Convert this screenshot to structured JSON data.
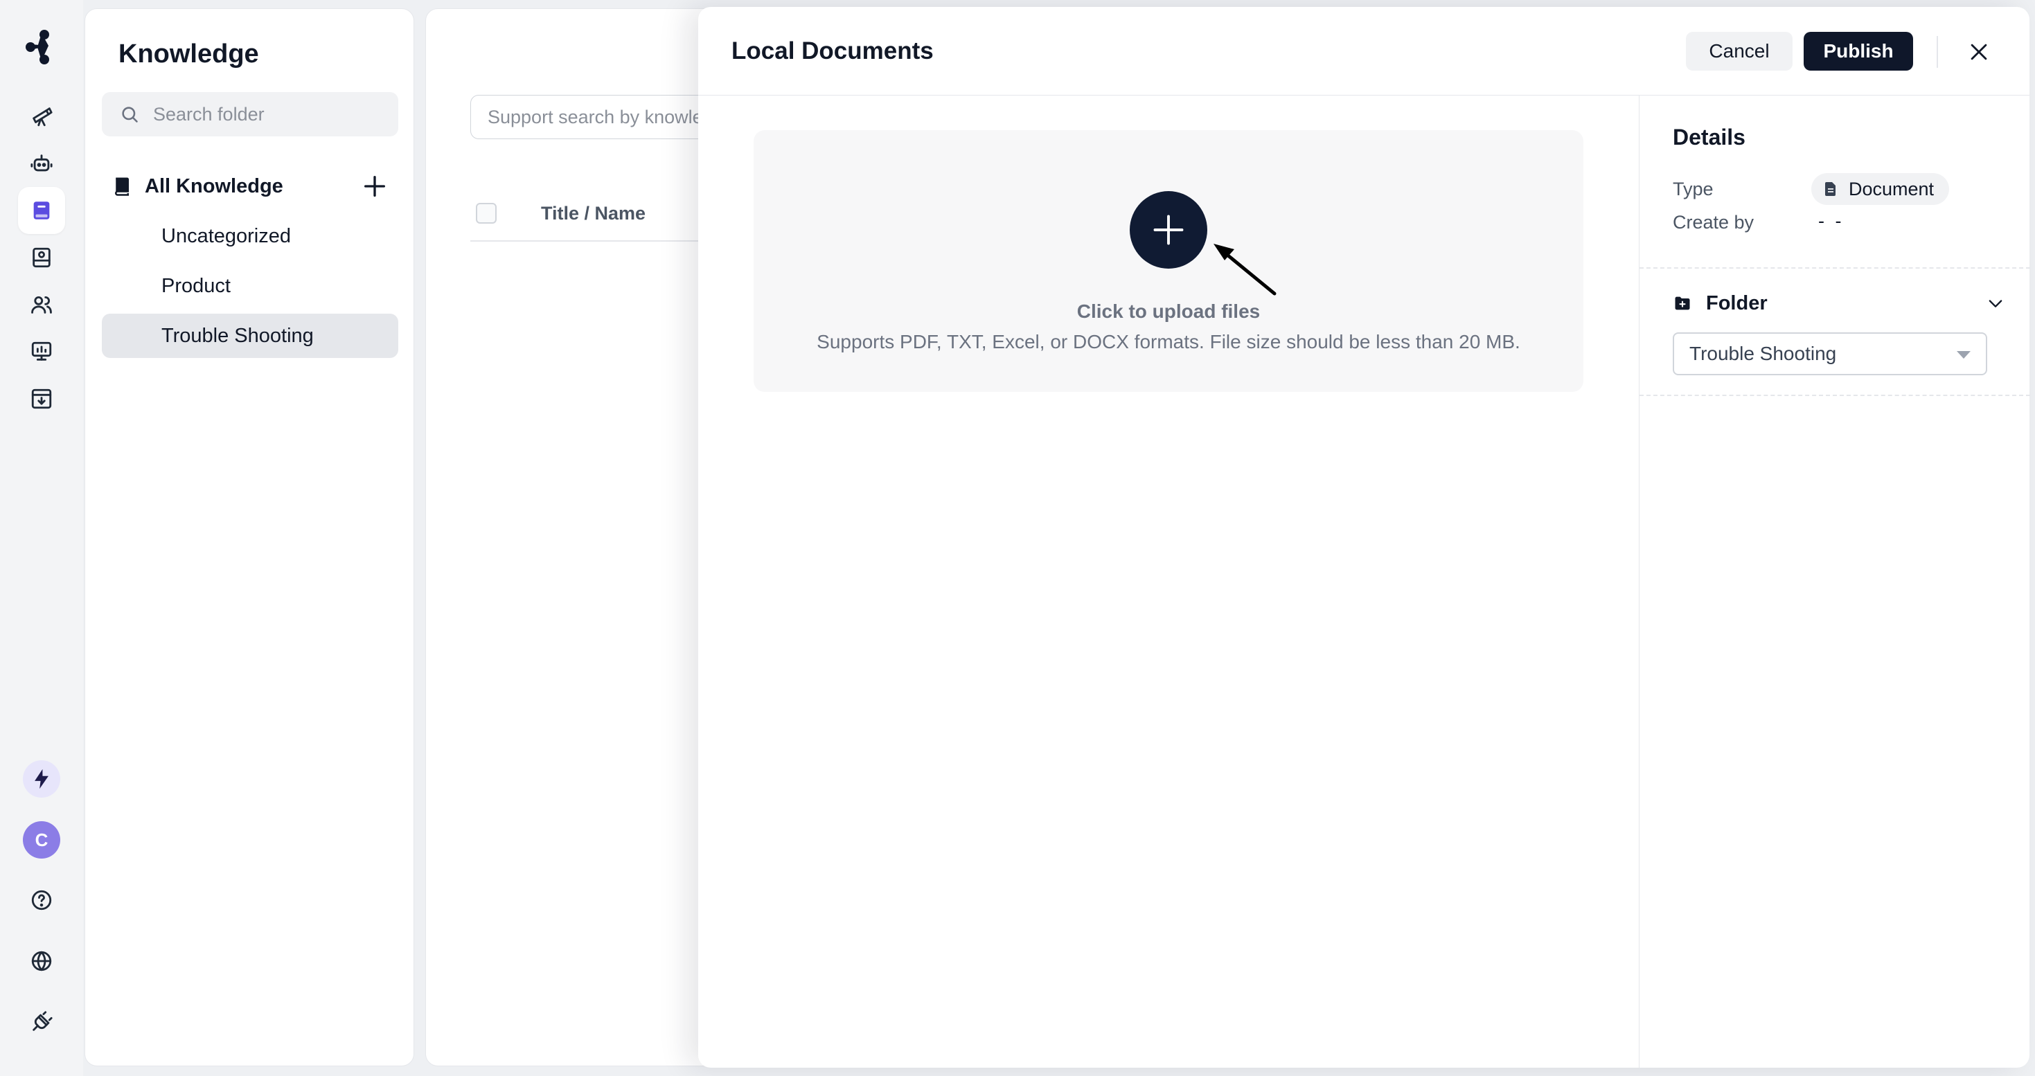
{
  "sidebar": {
    "title": "Knowledge",
    "search_placeholder": "Search folder",
    "all_label": "All Knowledge",
    "items": [
      {
        "label": "Uncategorized"
      },
      {
        "label": "Product"
      },
      {
        "label": "Trouble Shooting"
      }
    ]
  },
  "content": {
    "search_placeholder": "Support search by knowledge name",
    "column_title": "Title / Name"
  },
  "user": {
    "avatar_initial": "C"
  },
  "drawer": {
    "title": "Local Documents",
    "cancel_label": "Cancel",
    "publish_label": "Publish",
    "upload_title": "Click to upload files",
    "upload_desc": "Supports PDF, TXT, Excel, or DOCX formats. File size should be less than 20 MB.",
    "details": {
      "heading": "Details",
      "type_label": "Type",
      "type_value": "Document",
      "create_label": "Create by",
      "create_value": "- -",
      "folder_label": "Folder",
      "folder_value": "Trouble Shooting"
    }
  },
  "colors": {
    "primary_dark": "#0f172a",
    "accent": "#5b4ce0",
    "avatar": "#8b7de6"
  }
}
